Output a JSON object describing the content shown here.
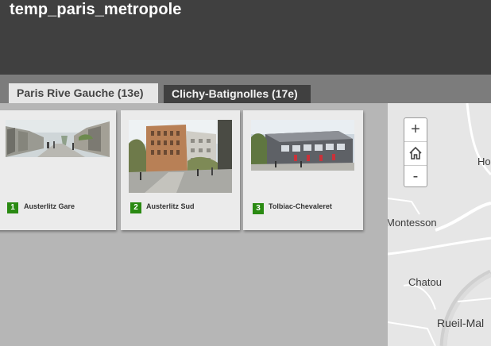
{
  "app": {
    "title": "temp_paris_metropole"
  },
  "tabs": [
    {
      "label": "Paris Rive Gauche (13e)",
      "active": true
    },
    {
      "label": "Clichy-Batignolles (17e)",
      "active": false
    }
  ],
  "cards": [
    {
      "number": "1",
      "caption": "Austerlitz Gare",
      "image": "street-photo"
    },
    {
      "number": "2",
      "caption": "Austerlitz Sud",
      "image": "building-render"
    },
    {
      "number": "3",
      "caption": "Tolbiac-Chevaleret",
      "image": "building-render"
    }
  ],
  "map": {
    "zoom_in": "+",
    "zoom_out": "-",
    "places": [
      "Ho",
      "Montesson",
      "Chatou",
      "Rueil-Mal"
    ]
  },
  "colors": {
    "header": "#404040",
    "badge": "#2a8a12",
    "tab_active": "#e6e6e6"
  }
}
